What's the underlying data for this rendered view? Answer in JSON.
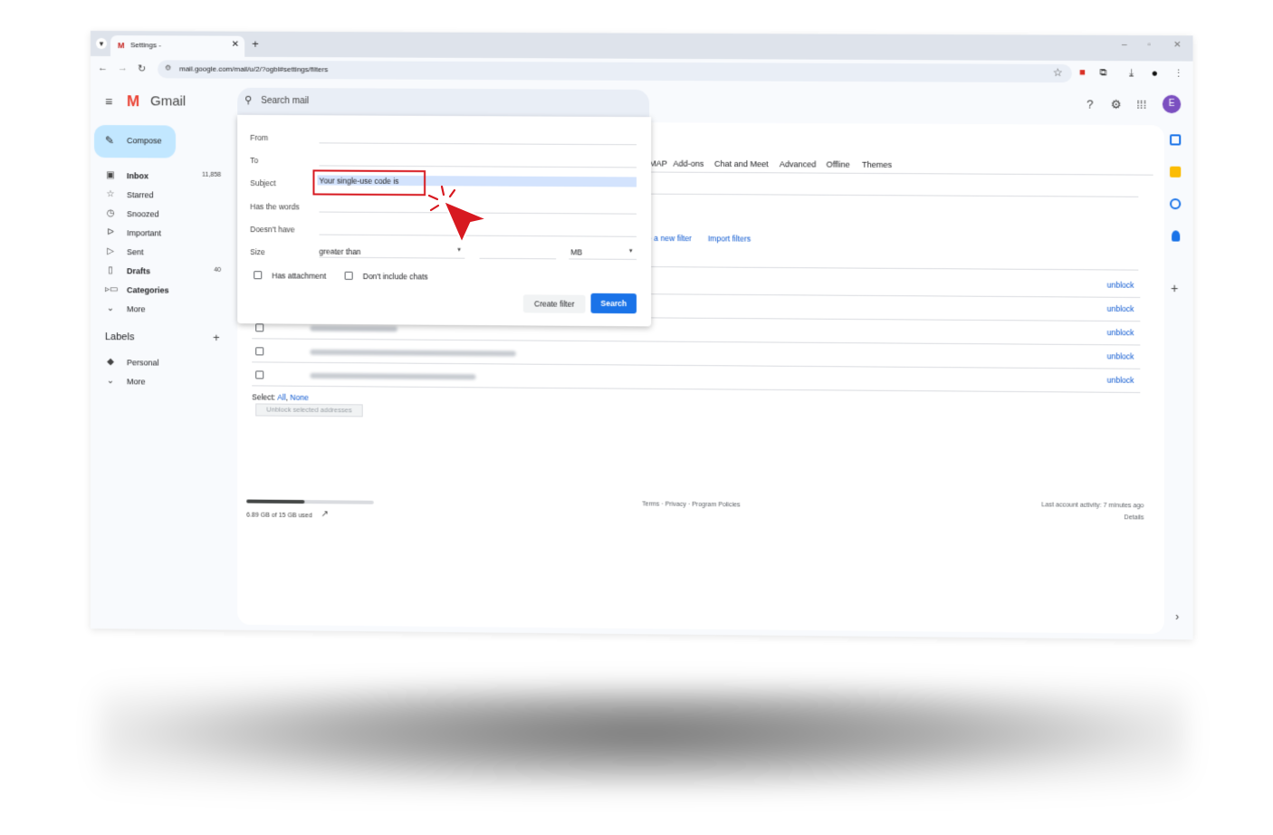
{
  "browser": {
    "tab_title": "Settings -",
    "tab_favicon": "M",
    "close_glyph": "✕",
    "new_tab_glyph": "+",
    "url": "mail.google.com/mail/u/2/?ogbl#settings/filters",
    "window_controls": [
      "–",
      "▫",
      "✕"
    ]
  },
  "gmail": {
    "logo_letter": "M",
    "logo_text": "Gmail",
    "search_placeholder": "Search mail",
    "avatar_letter": "E",
    "compose_label": "Compose"
  },
  "sidebar": {
    "items": [
      {
        "label": "Inbox",
        "count": "11,858",
        "icon": "inbox-icon",
        "bold": true
      },
      {
        "label": "Starred",
        "count": "",
        "icon": "star-icon",
        "bold": false
      },
      {
        "label": "Snoozed",
        "count": "",
        "icon": "clock-icon",
        "bold": false
      },
      {
        "label": "Important",
        "count": "",
        "icon": "important-icon",
        "bold": false
      },
      {
        "label": "Sent",
        "count": "",
        "icon": "send-icon",
        "bold": false
      },
      {
        "label": "Drafts",
        "count": "40",
        "icon": "draft-icon",
        "bold": true
      },
      {
        "label": "Categories",
        "count": "",
        "icon": "label-icon",
        "bold": true
      },
      {
        "label": "More",
        "count": "",
        "icon": "chevron-down-icon",
        "bold": false
      }
    ],
    "labels_heading": "Labels",
    "labels": [
      {
        "label": "Personal",
        "icon": "label-filled-icon"
      },
      {
        "label": "More",
        "icon": "chevron-down-icon"
      }
    ]
  },
  "settings": {
    "tabs": [
      "MAP",
      "Add-ons",
      "Chat and Meet",
      "Advanced",
      "Offline",
      "Themes"
    ],
    "filter_links": [
      "e a new filter",
      "Import filters"
    ],
    "unblock_label": "unblock",
    "select_prefix": "Select:",
    "select_all": "All",
    "select_none": "None",
    "unblock_selected": "Unblock selected addresses",
    "storage_text": "6.89 GB of 15 GB used",
    "storage_fraction": 0.459,
    "footer_links": "Terms · Privacy · Program Policies",
    "last_activity": "Last account activity: 7 minutes ago",
    "details": "Details"
  },
  "search_dialog": {
    "fields": [
      "From",
      "To",
      "Subject",
      "Has the words",
      "Doesn't have",
      "Size"
    ],
    "subject_value": "Your single-use code is",
    "size_operator": "greater than",
    "size_unit": "MB",
    "has_attachment": "Has attachment",
    "dont_include_chats": "Don't include chats",
    "create_filter": "Create filter",
    "search_button": "Search"
  },
  "colors": {
    "accent": "#0b57d0",
    "highlight_box": "#d71920",
    "cursor": "#d71920",
    "compose_bg": "#c2e7ff",
    "search_button": "#1a73e8"
  }
}
